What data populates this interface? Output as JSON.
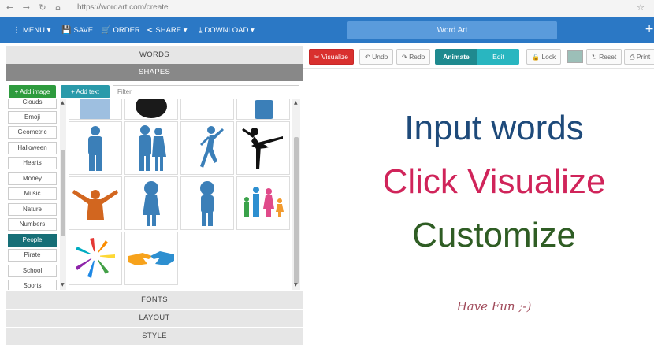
{
  "browser": {
    "nav_glyphs": "← → ↻ ⌂",
    "url": "https://wordart.com/create",
    "star": "☆"
  },
  "toolbar": {
    "menu": "MENU ▾",
    "save": "SAVE",
    "order": "ORDER",
    "share": "SHARE ▾",
    "download": "DOWNLOAD ▾",
    "title": "Word Art",
    "plus": "+"
  },
  "sections": {
    "words": "WORDS",
    "shapes": "SHAPES",
    "fonts": "FONTS",
    "layout": "LAYOUT",
    "style": "STYLE"
  },
  "shapes_panel": {
    "add_image": "+ Add image",
    "add_text": "+ Add text",
    "filter_placeholder": "Filter",
    "categories": [
      "Clouds",
      "Emoji",
      "Geometric",
      "Halloween",
      "Hearts",
      "Money",
      "Music",
      "Nature",
      "Numbers",
      "People",
      "Pirate",
      "School",
      "Sports"
    ],
    "selected_category": "People"
  },
  "controls": {
    "visualize": "Visualize",
    "undo": "Undo",
    "redo": "Redo",
    "animate": "Animate",
    "edit": "Edit",
    "lock": "Lock",
    "reset": "Reset",
    "print": "Print"
  },
  "canvas": {
    "line1": "Input words",
    "line2": "Click Visualize",
    "line3": "Customize",
    "line4": "Have Fun ;-)"
  },
  "colors": {
    "toolbar": "#2b78c5",
    "visualize": "#d9302e",
    "selected_category": "#176f77",
    "line1": "#1e4a7a",
    "line2": "#d0245a",
    "line3": "#2f5d24",
    "line4": "#a04a5a",
    "shape_blue": "#3b7fb8"
  }
}
